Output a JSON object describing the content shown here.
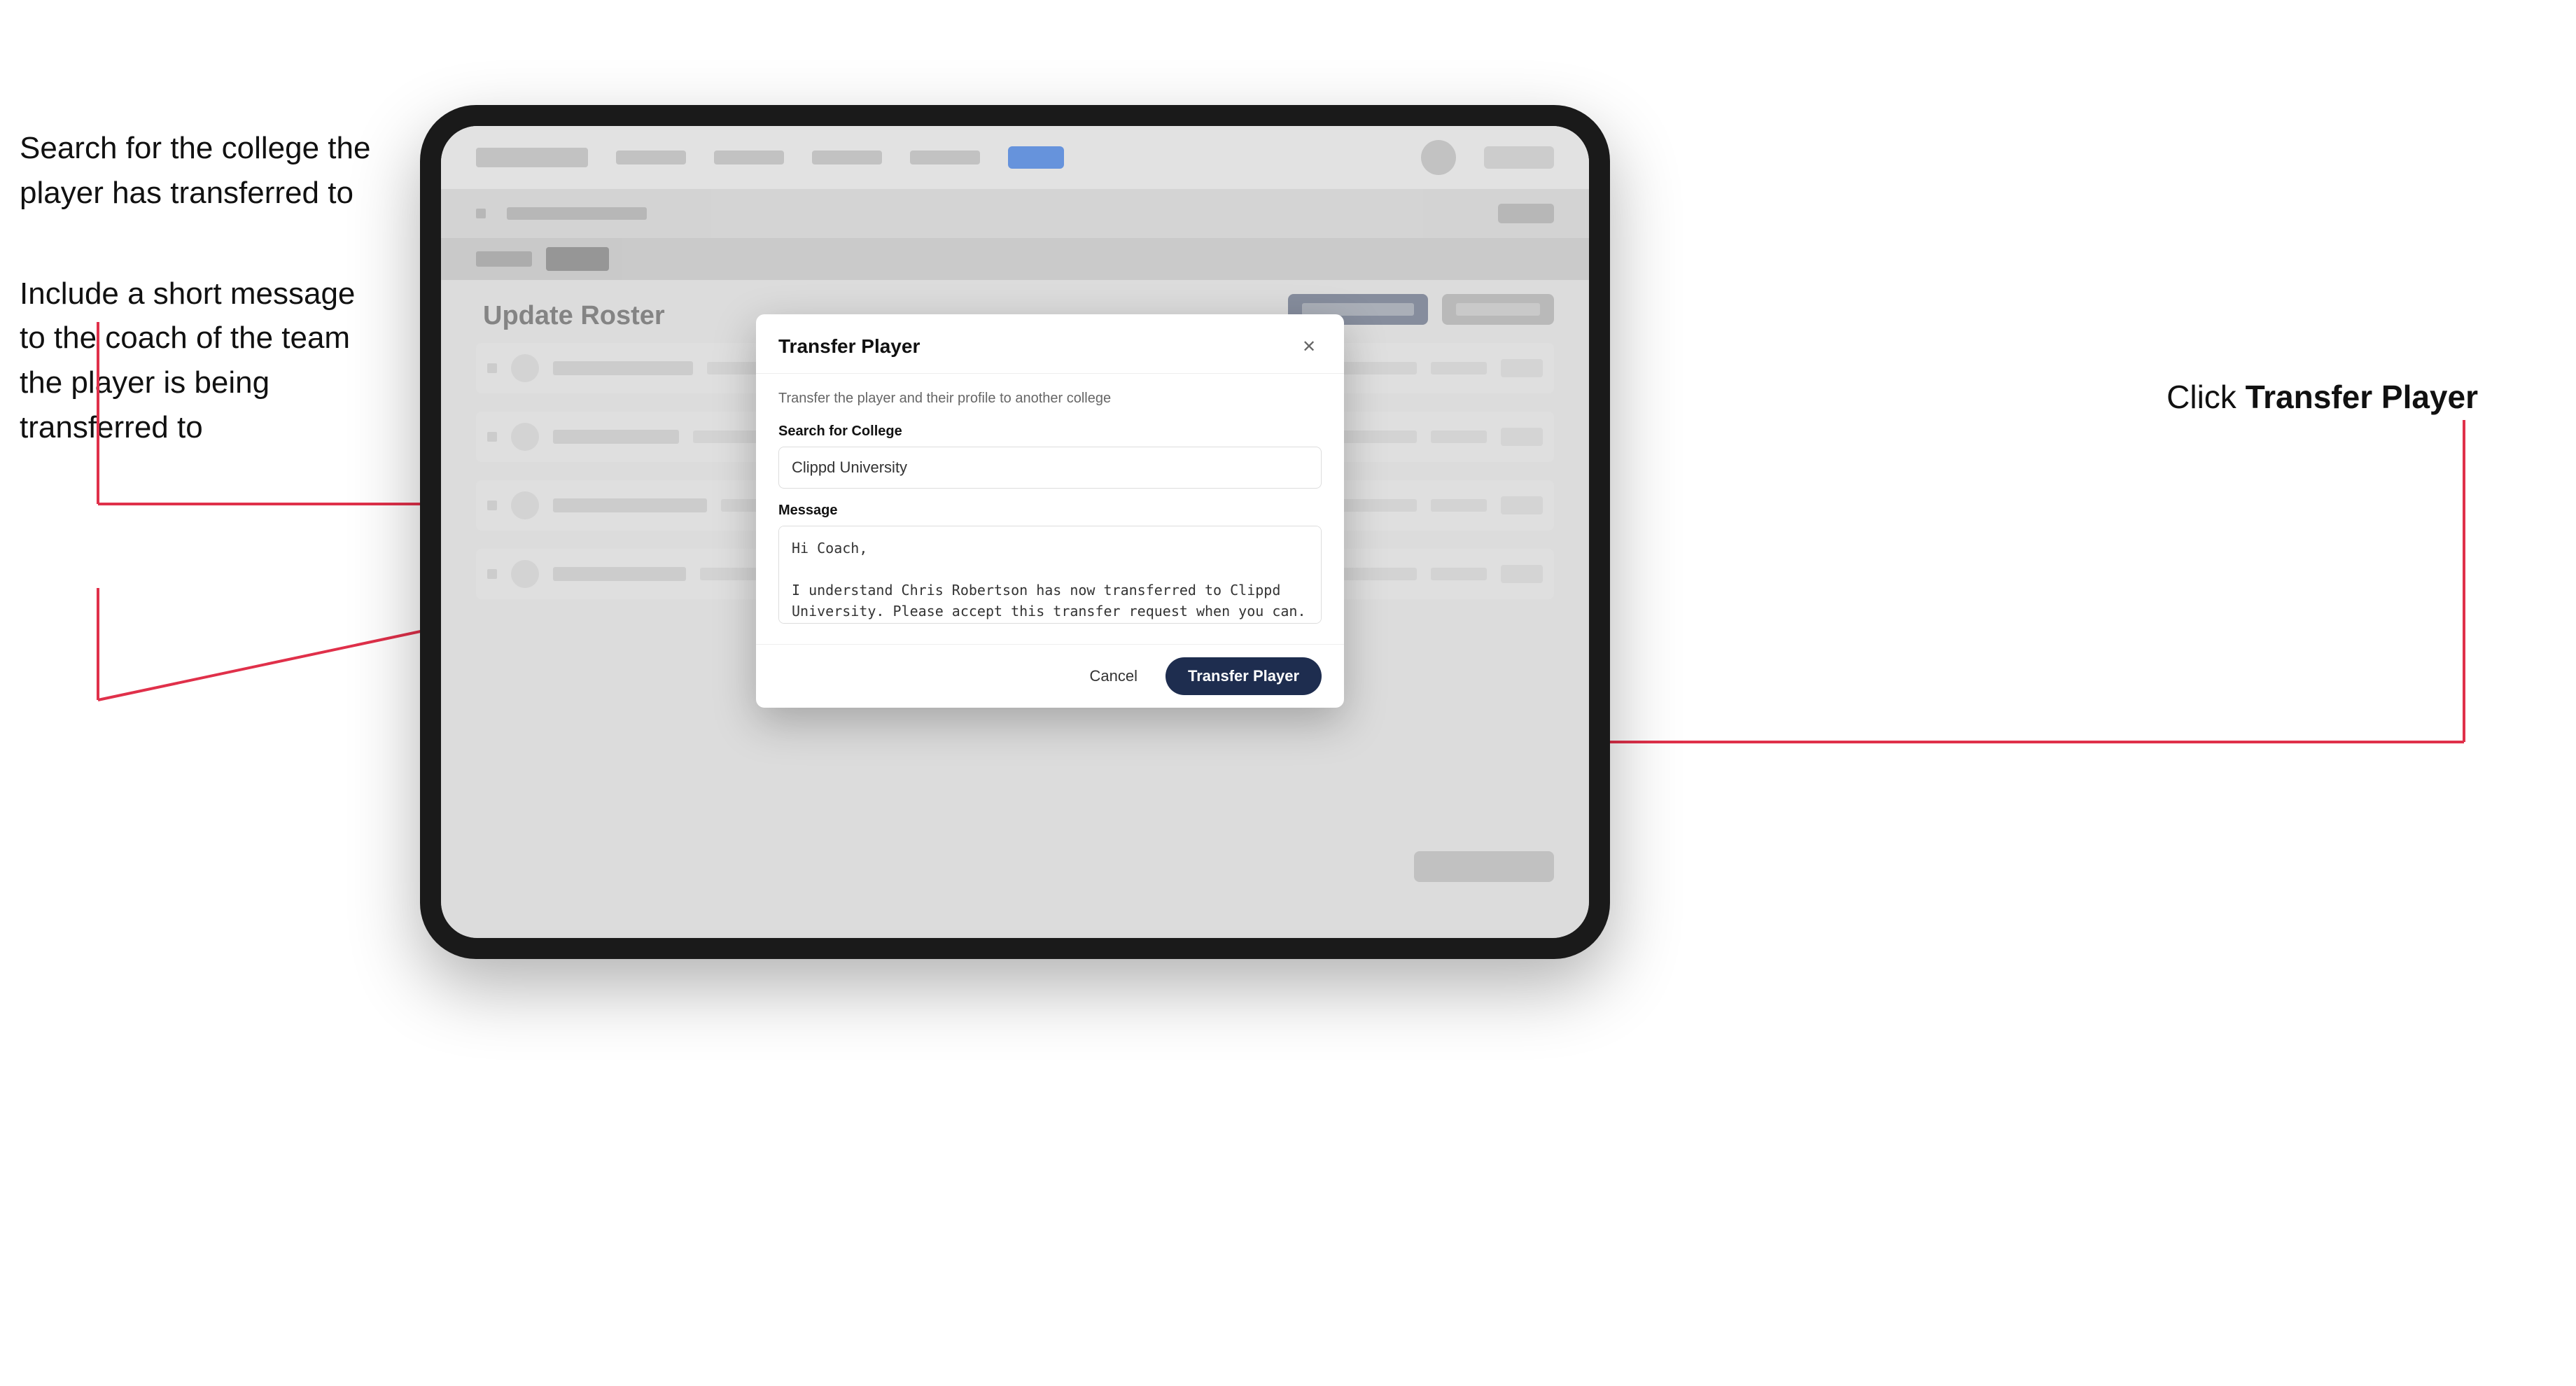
{
  "annotations": {
    "left_1_line1": "Search for the college the",
    "left_1_line2": "player has transferred to",
    "left_2_line1": "Include a short message",
    "left_2_line2": "to the coach of the team",
    "left_2_line3": "the player is being",
    "left_2_line4": "transferred to",
    "right_1_prefix": "Click ",
    "right_1_bold": "Transfer Player"
  },
  "modal": {
    "title": "Transfer Player",
    "subtitle": "Transfer the player and their profile to another college",
    "college_label": "Search for College",
    "college_value": "Clippd University",
    "message_label": "Message",
    "message_value": "Hi Coach,\n\nI understand Chris Robertson has now transferred to Clippd University. Please accept this transfer request when you can.",
    "cancel_label": "Cancel",
    "transfer_label": "Transfer Player"
  },
  "blurred_app": {
    "page_title": "Update Roster"
  }
}
